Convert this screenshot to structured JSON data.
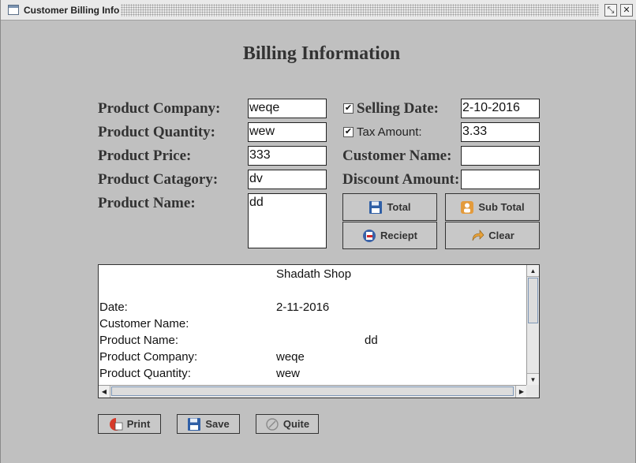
{
  "window": {
    "title": "Customer Billing Info"
  },
  "heading": "Billing Information",
  "form": {
    "product_company": {
      "label": "Product Company:",
      "value": "weqe"
    },
    "product_quantity": {
      "label": "Product Quantity:",
      "value": "wew"
    },
    "product_price": {
      "label": "Product Price:",
      "value": "333"
    },
    "product_category": {
      "label": "Product Catagory:",
      "value": "dv"
    },
    "product_name": {
      "label": "Product Name:",
      "value": "dd"
    },
    "selling_date": {
      "label": "Selling Date:",
      "value": "2-10-2016",
      "checked": true
    },
    "tax_amount": {
      "label": "Tax Amount:",
      "value": "3.33",
      "checked": true
    },
    "customer_name": {
      "label": "Customer Name:",
      "value": ""
    },
    "discount_amount": {
      "label": "Discount Amount:",
      "value": ""
    }
  },
  "actions": {
    "total": "Total",
    "sub_total": "Sub Total",
    "receipt": "Reciept",
    "clear": "Clear"
  },
  "receipt": {
    "shop": "Shadath Shop",
    "date_label": "Date:",
    "date_value": "2-11-2016",
    "customer_label": "Customer Name:",
    "product_name_label": "Product Name:",
    "product_name_value": "dd",
    "company_label": "Product Company:",
    "company_value": "weqe",
    "quantity_label": "Product Quantity:",
    "quantity_value": "wew"
  },
  "footer": {
    "print": "Print",
    "save": "Save",
    "quit": "Quite"
  },
  "icons": {
    "window": "window-icon",
    "restore": "restore-icon",
    "close": "close-icon",
    "save": "floppy-disk-icon",
    "subtotal": "person-badge-icon",
    "receipt": "receipt-icon",
    "clear": "redo-arrow-icon",
    "print": "printer-icon",
    "quit": "quit-icon"
  },
  "colors": {
    "background": "#c0c0c0",
    "field": "#ffffff",
    "accent": "#7e98b8"
  }
}
